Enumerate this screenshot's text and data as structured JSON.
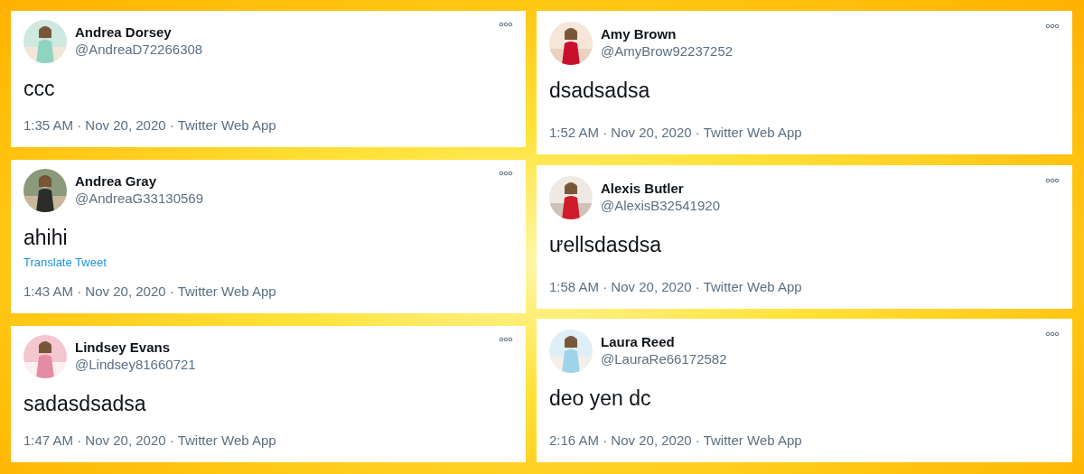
{
  "columns": [
    {
      "tweets": [
        {
          "name": "Andrea Dorsey",
          "handle": "@AndreaD72266308",
          "text": "ccc",
          "meta": "1:35 AM · Nov 20, 2020 · Twitter Web App"
        },
        {
          "name": "Andrea Gray",
          "handle": "@AndreaG33130569",
          "text": "ahihi",
          "translate": "Translate Tweet",
          "meta": "1:43 AM · Nov 20, 2020 · Twitter Web App"
        },
        {
          "name": "Lindsey Evans",
          "handle": "@Lindsey81660721",
          "text": "sadasdsadsa",
          "meta": "1:47 AM · Nov 20, 2020 · Twitter Web App"
        }
      ]
    },
    {
      "tweets": [
        {
          "name": "Amy Brown",
          "handle": "@AmyBrow92237252",
          "text": "dsadsadsa",
          "meta": "1:52 AM · Nov 20, 2020 · Twitter Web App"
        },
        {
          "name": "Alexis Butler",
          "handle": "@AlexisB32541920",
          "text": "ưellsdasdsa",
          "meta": "1:58 AM · Nov 20, 2020 · Twitter Web App"
        },
        {
          "name": "Laura Reed",
          "handle": "@LauraRe66172582",
          "text": "deo yen dc",
          "meta": "2:16 AM · Nov 20, 2020 · Twitter Web App"
        }
      ]
    }
  ]
}
